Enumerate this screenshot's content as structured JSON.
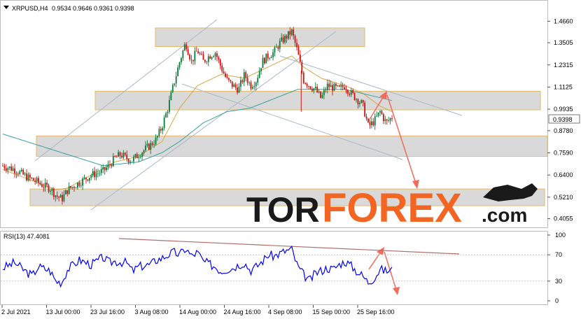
{
  "chart_data": [
    {
      "type": "candlestick",
      "title": "XRPUSD,H4",
      "ohlc_label": "0.9534 0.9646 0.9361 0.9398",
      "last_price": "0.9398",
      "y_scale": "linear",
      "ylim": [
        0.37,
        1.55
      ],
      "y_ticks": [
        "1.4660",
        "1.3505",
        "1.2315",
        "1.1125",
        "0.9935",
        "0.8780",
        "0.7590",
        "0.6400",
        "0.5210",
        "0.4055"
      ],
      "x_ticks": [
        "2 Jul 2021",
        "13 Jul 00:00",
        "23 Jul 16:00",
        "3 Aug 08:00",
        "14 Aug 00:00",
        "24 Aug 16:00",
        "4 Sep 08:00",
        "15 Sep 00:00",
        "25 Sep 16:00"
      ],
      "series": [
        {
          "name": "price",
          "kind": "candles",
          "path": [
            [
              0,
              0.69
            ],
            [
              2,
              0.67
            ],
            [
              4,
              0.63
            ],
            [
              6,
              0.6
            ],
            [
              7,
              0.58
            ],
            [
              8,
              0.57
            ],
            [
              9,
              0.53
            ],
            [
              10,
              0.51
            ],
            [
              11,
              0.56
            ],
            [
              13,
              0.6
            ],
            [
              15,
              0.64
            ],
            [
              17,
              0.66
            ],
            [
              18,
              0.69
            ],
            [
              19,
              0.73
            ],
            [
              20,
              0.75
            ],
            [
              21,
              0.73
            ],
            [
              22,
              0.72
            ],
            [
              23,
              0.75
            ],
            [
              25,
              0.8
            ],
            [
              26,
              0.83
            ],
            [
              27,
              0.9
            ],
            [
              28,
              1.0
            ],
            [
              29,
              1.13
            ],
            [
              30,
              1.25
            ],
            [
              31,
              1.35
            ],
            [
              32,
              1.25
            ],
            [
              33,
              1.31
            ],
            [
              34,
              1.25
            ],
            [
              35,
              1.28
            ],
            [
              36,
              1.3
            ],
            [
              37,
              1.22
            ],
            [
              38,
              1.15
            ],
            [
              39,
              1.12
            ],
            [
              40,
              1.1
            ],
            [
              41,
              1.18
            ],
            [
              42,
              1.12
            ],
            [
              43,
              1.15
            ],
            [
              44,
              1.25
            ],
            [
              45,
              1.28
            ],
            [
              46,
              1.3
            ],
            [
              47,
              1.35
            ],
            [
              48,
              1.38
            ],
            [
              49,
              1.41
            ],
            [
              50,
              1.3
            ],
            [
              51,
              1.15
            ],
            [
              52,
              1.12
            ],
            [
              53,
              1.1
            ],
            [
              54,
              1.05
            ],
            [
              55,
              1.12
            ],
            [
              57,
              1.1
            ],
            [
              58,
              1.12
            ],
            [
              59,
              1.08
            ],
            [
              60,
              1.05
            ],
            [
              61,
              1.02
            ],
            [
              62,
              0.9
            ],
            [
              63,
              0.93
            ],
            [
              64,
              0.98
            ],
            [
              65,
              0.92
            ],
            [
              66,
              0.95
            ]
          ]
        },
        {
          "name": "ma_fast",
          "kind": "line",
          "color": "#d4a64a",
          "path": [
            [
              0,
              0.67
            ],
            [
              5,
              0.61
            ],
            [
              9,
              0.56
            ],
            [
              11,
              0.57
            ],
            [
              15,
              0.64
            ],
            [
              19,
              0.71
            ],
            [
              23,
              0.74
            ],
            [
              27,
              0.82
            ],
            [
              30,
              1.0
            ],
            [
              33,
              1.12
            ],
            [
              37,
              1.18
            ],
            [
              41,
              1.16
            ],
            [
              45,
              1.22
            ],
            [
              49,
              1.28
            ],
            [
              51,
              1.22
            ],
            [
              54,
              1.16
            ],
            [
              58,
              1.12
            ],
            [
              61,
              1.08
            ],
            [
              64,
              1.01
            ],
            [
              66,
              0.98
            ]
          ]
        },
        {
          "name": "ma_slow",
          "kind": "line",
          "color": "#3aa0a0",
          "path": [
            [
              0,
              0.86
            ],
            [
              10,
              0.76
            ],
            [
              17,
              0.69
            ],
            [
              23,
              0.71
            ],
            [
              27,
              0.76
            ],
            [
              30,
              0.82
            ],
            [
              34,
              0.92
            ],
            [
              38,
              0.98
            ],
            [
              42,
              1.0
            ],
            [
              46,
              1.05
            ],
            [
              50,
              1.1
            ],
            [
              54,
              1.1
            ],
            [
              58,
              1.1
            ],
            [
              62,
              1.07
            ],
            [
              66,
              1.04
            ]
          ]
        }
      ],
      "zones": [
        [
          1.33,
          1.43
        ],
        [
          0.99,
          1.09
        ],
        [
          0.74,
          0.85
        ],
        [
          0.475,
          0.565
        ]
      ],
      "watermark": {
        "dark": "TOR",
        "accent": "FOREX",
        "suffix": ".com",
        "accent_color": "#f26522"
      }
    },
    {
      "type": "line",
      "title": "RSI(13) 47.4081",
      "ylim": [
        0,
        100
      ],
      "y_ticks": [
        "100",
        "70",
        "30",
        "0"
      ],
      "levels": [
        70,
        30
      ],
      "series": [
        {
          "name": "RSI",
          "color": "#0000ff",
          "path": [
            [
              0,
              50
            ],
            [
              2,
              58
            ],
            [
              4,
              44
            ],
            [
              5,
              38
            ],
            [
              6,
              52
            ],
            [
              8,
              46
            ],
            [
              9,
              30
            ],
            [
              10,
              28
            ],
            [
              11,
              48
            ],
            [
              13,
              62
            ],
            [
              15,
              55
            ],
            [
              17,
              66
            ],
            [
              18,
              58
            ],
            [
              19,
              60
            ],
            [
              21,
              58
            ],
            [
              22,
              45
            ],
            [
              23,
              52
            ],
            [
              25,
              55
            ],
            [
              26,
              62
            ],
            [
              27,
              65
            ],
            [
              28,
              70
            ],
            [
              29,
              74
            ],
            [
              30,
              70
            ],
            [
              31,
              80
            ],
            [
              32,
              68
            ],
            [
              33,
              74
            ],
            [
              34,
              60
            ],
            [
              35,
              56
            ],
            [
              36,
              52
            ],
            [
              37,
              45
            ],
            [
              38,
              48
            ],
            [
              39,
              50
            ],
            [
              40,
              55
            ],
            [
              41,
              58
            ],
            [
              42,
              46
            ],
            [
              43,
              52
            ],
            [
              44,
              60
            ],
            [
              45,
              70
            ],
            [
              46,
              68
            ],
            [
              47,
              72
            ],
            [
              48,
              76
            ],
            [
              49,
              78
            ],
            [
              50,
              52
            ],
            [
              51,
              40
            ],
            [
              52,
              30
            ],
            [
              53,
              42
            ],
            [
              54,
              46
            ],
            [
              55,
              50
            ],
            [
              56,
              48
            ],
            [
              57,
              55
            ],
            [
              58,
              60
            ],
            [
              59,
              54
            ],
            [
              60,
              45
            ],
            [
              61,
              38
            ],
            [
              62,
              28
            ],
            [
              63,
              35
            ],
            [
              64,
              48
            ],
            [
              65,
              45
            ],
            [
              66,
              47
            ]
          ]
        }
      ]
    }
  ]
}
